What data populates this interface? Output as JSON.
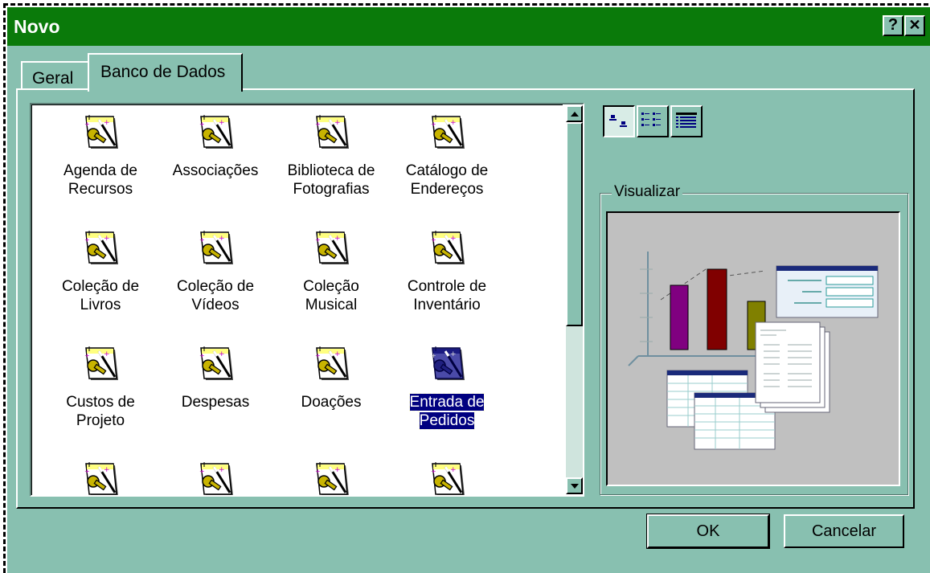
{
  "window": {
    "title": "Novo",
    "help_glyph": "?",
    "close_glyph": "✕",
    "titlebar_color": "#0a7a0a",
    "face_color": "#88c0b0"
  },
  "tabs": [
    {
      "label": "Geral",
      "active": false
    },
    {
      "label": "Banco de Dados",
      "active": true
    }
  ],
  "templates": [
    {
      "label": "Agenda de\nRecursos",
      "icon": "database-wizard-icon"
    },
    {
      "label": "Associações",
      "icon": "database-wizard-icon"
    },
    {
      "label": "Biblioteca de\nFotografias",
      "icon": "database-wizard-icon"
    },
    {
      "label": "Catálogo de\nEndereços",
      "icon": "database-wizard-icon"
    },
    {
      "label": "Coleção de\nLivros",
      "icon": "database-wizard-icon"
    },
    {
      "label": "Coleção de\nVídeos",
      "icon": "database-wizard-icon"
    },
    {
      "label": "Coleção\nMusical",
      "icon": "database-wizard-icon"
    },
    {
      "label": "Controle de\nInventário",
      "icon": "database-wizard-icon"
    },
    {
      "label": "Custos de\nProjeto",
      "icon": "database-wizard-icon"
    },
    {
      "label": "Despesas",
      "icon": "database-wizard-icon"
    },
    {
      "label": "Doações",
      "icon": "database-wizard-icon"
    },
    {
      "label": "Entrada de\nPedidos",
      "icon": "database-wizard-icon",
      "selected": true
    },
    {
      "label": "",
      "icon": "database-wizard-icon"
    },
    {
      "label": "",
      "icon": "database-wizard-icon"
    },
    {
      "label": "",
      "icon": "database-wizard-icon"
    },
    {
      "label": "",
      "icon": "database-wizard-icon"
    }
  ],
  "view_buttons": [
    {
      "name": "large-icons-view-icon",
      "active": true
    },
    {
      "name": "list-view-icon",
      "active": false
    },
    {
      "name": "details-view-icon",
      "active": false
    }
  ],
  "preview": {
    "label": "Visualizar",
    "image": "database-template-preview-icon"
  },
  "buttons": {
    "ok": "OK",
    "cancel": "Cancelar"
  },
  "selection_color": "#000080"
}
